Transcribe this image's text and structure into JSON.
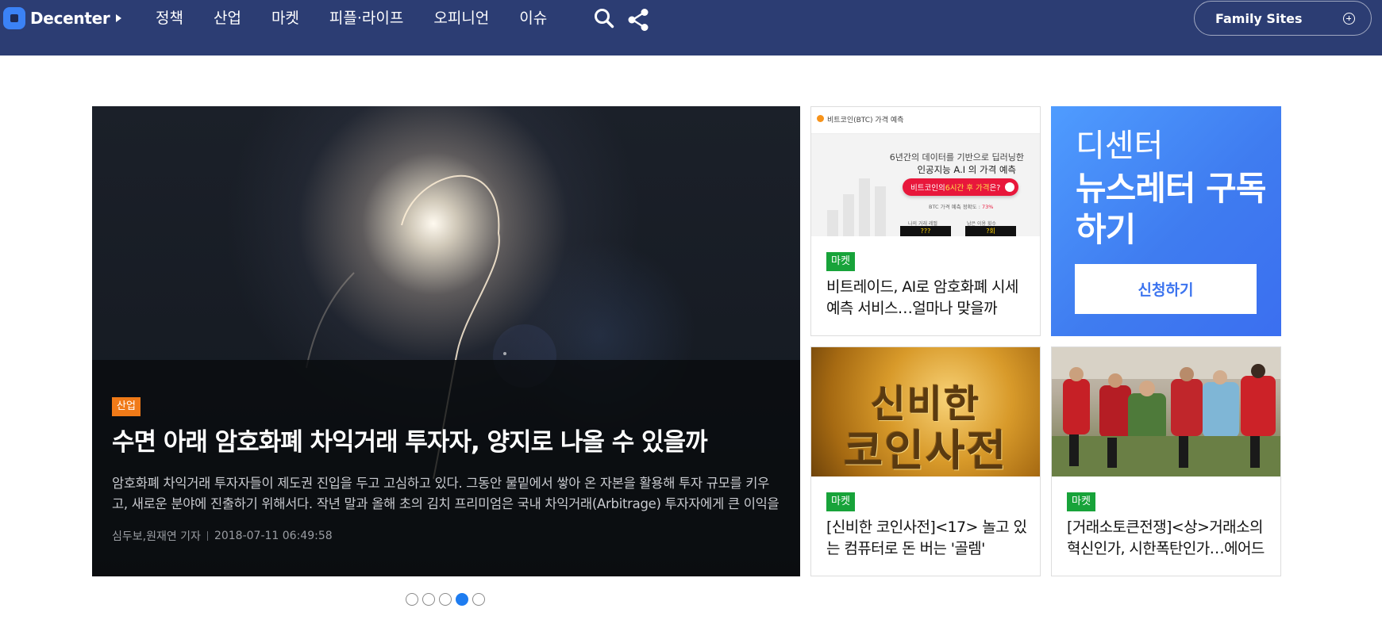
{
  "header": {
    "logo_text": "Decenter",
    "nav": [
      "정책",
      "산업",
      "마켓",
      "피플·라이프",
      "오피니언",
      "이슈"
    ],
    "family_sites": "Family Sites"
  },
  "hero": {
    "tag": "산업",
    "title": "수면 아래 암호화폐 차익거래 투자자, 양지로 나올 수 있을까",
    "summary": "암호화폐 차익거래 투자자들이 제도권 진입을 두고 고심하고 있다. 그동안 물밑에서 쌓아 온 자본을 활용해 투자 규모를 키우고, 새로운 분야에 진출하기 위해서다. 작년 말과 올해 초의 김치 프리미엄은 국내 차익거래(Arbitrage) 투자자에게 큰 이익을 …",
    "authors": "심두보,원재연 기자",
    "datetime": "2018-07-11 06:49:58"
  },
  "cards": [
    {
      "tag": "마켓",
      "title": "비트레이드, AI로 암호화폐 시세 예측 서비스…얼마나 맞을까",
      "thumb_text": {
        "header": "비트코인(BTC) 가격 예측",
        "line1": "6년간의 데이터를 기반으로 딥러닝한",
        "line2": "인공지능 A.I 의 가격 예측",
        "pill_prefix": "비트코인의 ",
        "pill_highlight": "6시간 후 가격",
        "pill_suffix": "은?",
        "accuracy_label": "BTC 가격 예측 정확도 : ",
        "accuracy_value": "73%",
        "label_left": "나의 거래 레벨",
        "label_right": "남은 이용 횟수",
        "box_left": "???",
        "box_right": "?회"
      }
    },
    {
      "tag": "마켓",
      "title": "[신비한 코인사전]<17> 놀고 있는 컴퓨터로 돈 버는 '골렘'",
      "thumb_text": {
        "line1": "신비한",
        "line2": "코인사전"
      }
    },
    {
      "tag": "마켓",
      "title": "[거래소토큰전쟁]<상>거래소의 혁신인가, 시한폭탄인가…에어드랍 논란",
      "thumb_text": {}
    }
  ],
  "promo": {
    "line_light": "디센터",
    "line_bold": "뉴스레터 구독하기",
    "button": "신청하기"
  },
  "pager": {
    "count": 5,
    "active_index": 3
  }
}
